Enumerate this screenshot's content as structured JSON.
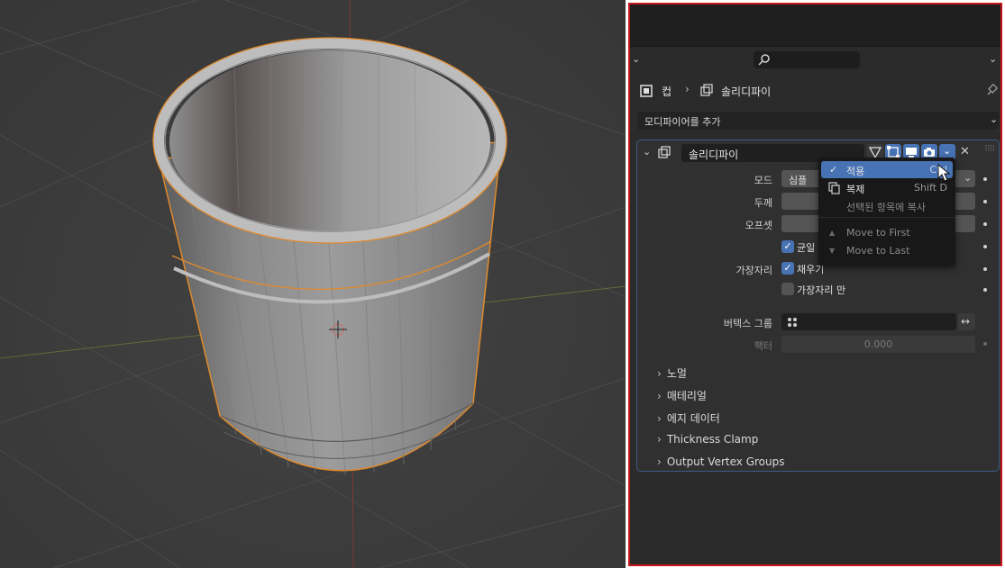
{
  "breadcrumb": {
    "object": "컵",
    "modifier": "솔리디파이"
  },
  "add_modifier": "모디파이어를 추가",
  "modifier": {
    "name": "솔리디파이",
    "rows": {
      "mode_label": "모드",
      "mode_value": "심플",
      "thickness_label": "두께",
      "offset_label": "오프셋",
      "even_label": "균일",
      "rim_label": "가장자리",
      "fill_label": "채우기",
      "rim_only_label": "가장자리 만",
      "vertex_group_label": "버텍스 그룹",
      "factor_label": "팩터",
      "factor_value": "0.000"
    },
    "subpanels": [
      "노멀",
      "매테리얼",
      "에지 데이터",
      "Thickness Clamp",
      "Output Vertex Groups"
    ]
  },
  "menu": {
    "items": [
      {
        "label": "적용",
        "shortcut": "Ctrl",
        "selected": true
      },
      {
        "label": "복제",
        "shortcut": "Shift D",
        "selected": false
      },
      {
        "label": "선택된 항목에 복사",
        "shortcut": "",
        "selected": false
      },
      {
        "label": "Move to First",
        "shortcut": "",
        "selected": false
      },
      {
        "label": "Move to Last",
        "shortcut": "",
        "selected": false
      }
    ]
  },
  "colors": {
    "accent": "#4772b3",
    "selection_outline": "#e08a2c",
    "frame": "#c4161c"
  }
}
